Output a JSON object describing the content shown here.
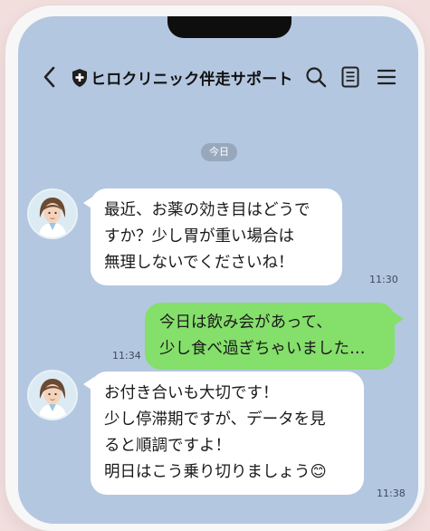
{
  "header": {
    "title": "ヒロクリニック伴走サポート",
    "back_icon": "back-arrow-icon",
    "shield_icon": "shield-plus-icon",
    "search_icon": "search-icon",
    "notes_icon": "notes-icon",
    "menu_icon": "hamburger-menu-icon"
  },
  "date_label": "今日",
  "messages": [
    {
      "side": "left",
      "text": "最近、お薬の効き目はどうで\nすか？少し胃が重い場合は\n無理しないでくださいね！",
      "time": "11:30"
    },
    {
      "side": "right",
      "text": "今日は飲み会があって、\n少し食べ過ぎちゃいました…",
      "time": "11:34"
    },
    {
      "side": "left",
      "text": "お付き合いも大切です！\n少し停滞期ですが、データを見\nると順調ですよ！\n明日はこう乗り切りましょう😊",
      "time": "11:38"
    }
  ],
  "colors": {
    "chat_background": "#b4c7e0",
    "outgoing_bubble": "#85df6b",
    "incoming_bubble": "#ffffff"
  }
}
